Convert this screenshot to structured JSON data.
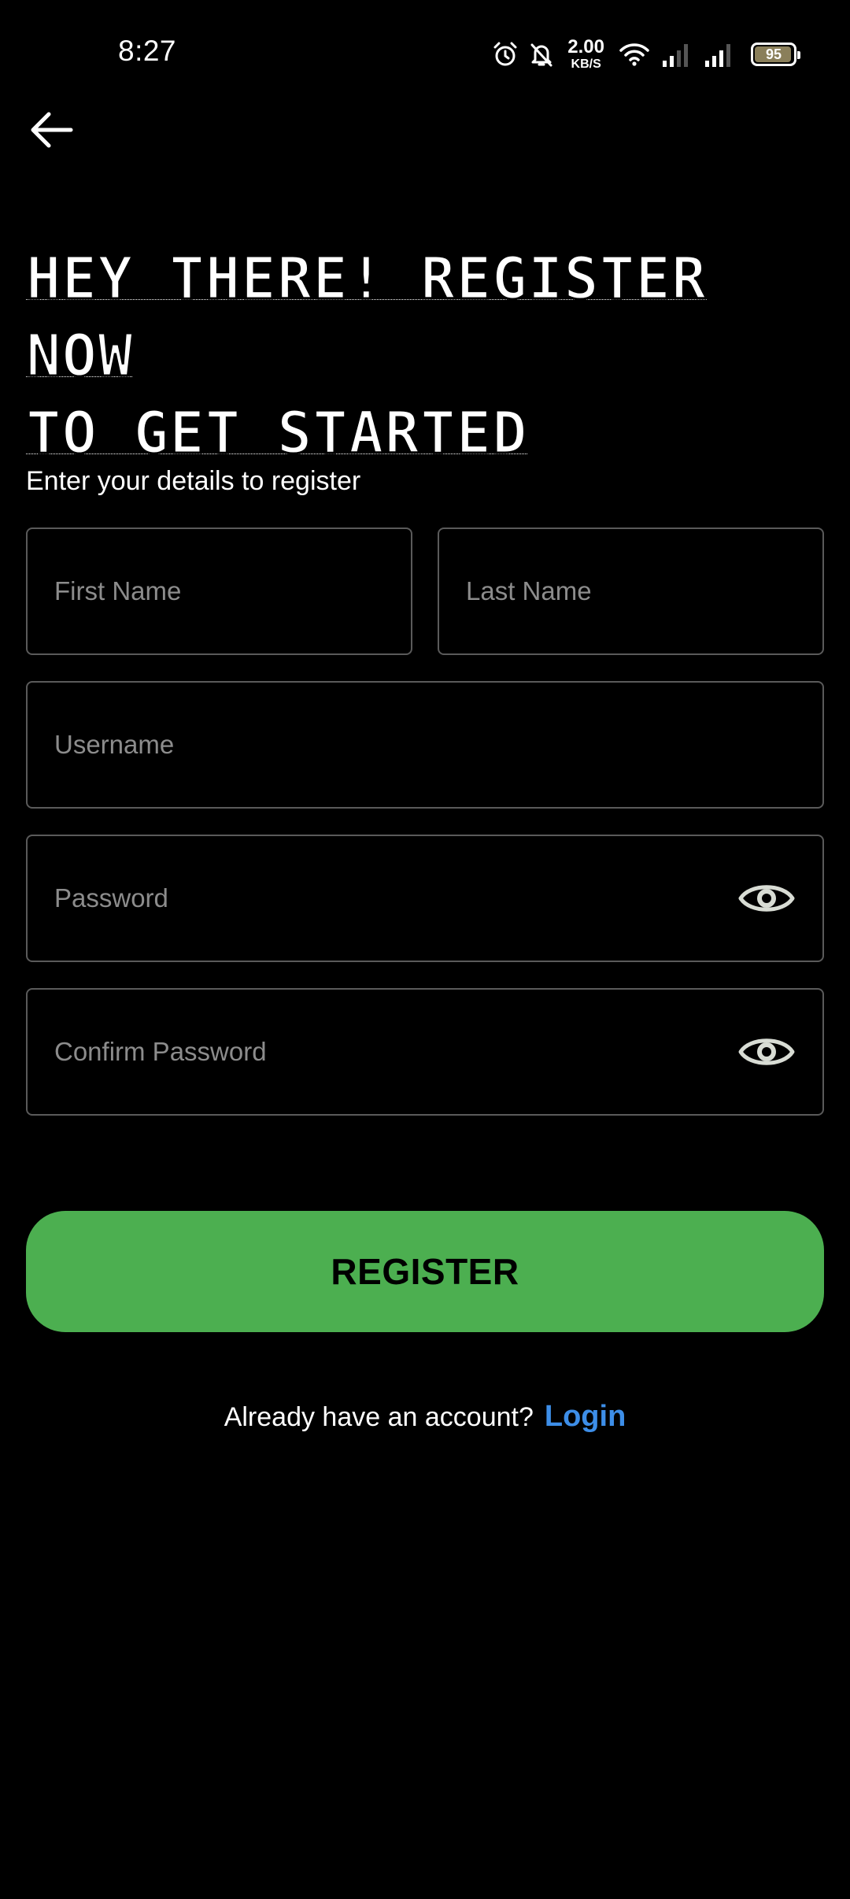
{
  "status_bar": {
    "time": "8:27",
    "net_speed_value": "2.00",
    "net_speed_unit": "KB/S",
    "battery_level": "95",
    "battery_percent": 95,
    "icons": [
      "alarm-icon",
      "notifications-muted-icon",
      "wifi-icon",
      "signal-icon",
      "signal-icon",
      "battery-icon"
    ]
  },
  "nav": {
    "back_icon": "arrow-left-icon"
  },
  "header": {
    "title_line1": "HEY THERE! REGISTER NOW",
    "title_line2": "TO GET STARTED"
  },
  "form": {
    "subtitle": "Enter your details to register",
    "first_name_placeholder": "First Name",
    "last_name_placeholder": "Last Name",
    "username_placeholder": "Username",
    "password_placeholder": "Password",
    "confirm_password_placeholder": "Confirm Password",
    "visibility_icon": "eye-icon",
    "register_label": "REGISTER"
  },
  "footer": {
    "prompt": "Already have an account?",
    "login_label": "Login"
  },
  "colors": {
    "background": "#000000",
    "accent_green": "#4caf50",
    "link_blue": "#3d8ee8",
    "field_border": "#5a5a5a",
    "placeholder": "#8c8c8c"
  }
}
